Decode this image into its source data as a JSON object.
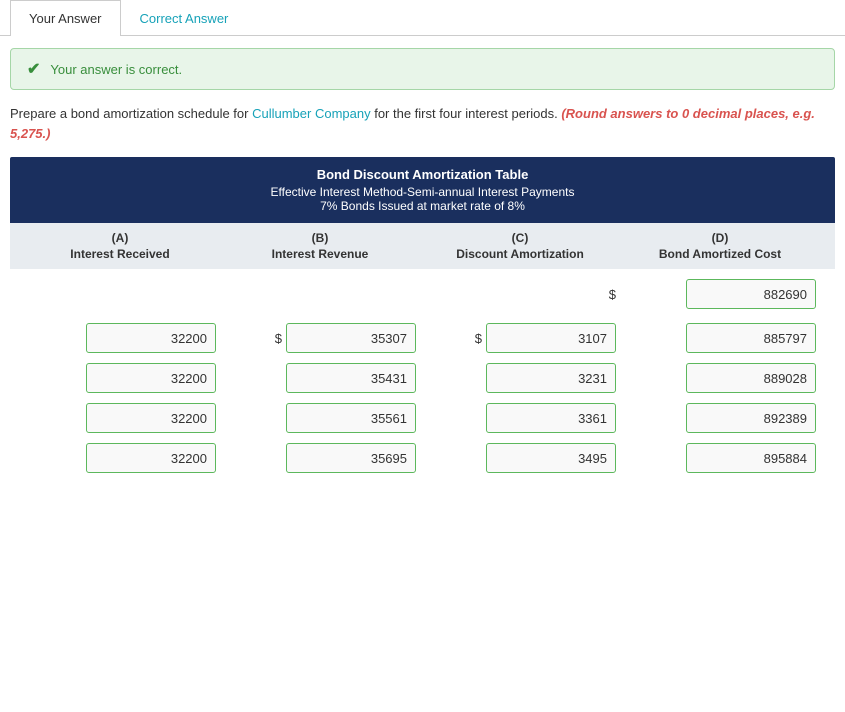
{
  "tabs": {
    "active": "Your Answer",
    "inactive": "Correct Answer"
  },
  "success": {
    "message": "Your answer is correct."
  },
  "instruction": {
    "prefix": "Prepare a bond amortization schedule for ",
    "company": "Cullumber Company",
    "middle": " for the first four interest periods. ",
    "warning": "(Round answers to 0 decimal places, e.g. 5,275.)"
  },
  "table": {
    "title": "Bond Discount Amortization Table",
    "subtitle1": "Effective Interest Method-Semi-annual Interest Payments",
    "subtitle2": "7% Bonds Issued at market rate of 8%",
    "columns": [
      {
        "letter": "(A)",
        "name": "Interest Received"
      },
      {
        "letter": "(B)",
        "name": "Interest Revenue"
      },
      {
        "letter": "(C)",
        "name": "Discount Amortization"
      },
      {
        "letter": "(D)",
        "name": "Bond Amortized Cost"
      }
    ],
    "initial": {
      "col_d": "882690"
    },
    "rows": [
      {
        "a": "32200",
        "b_dollar": "$",
        "b": "35307",
        "c_dollar": "$",
        "c": "3107",
        "d": "885797"
      },
      {
        "a": "32200",
        "b_dollar": "",
        "b": "35431",
        "c_dollar": "",
        "c": "3231",
        "d": "889028"
      },
      {
        "a": "32200",
        "b_dollar": "",
        "b": "35561",
        "c_dollar": "",
        "c": "3361",
        "d": "892389"
      },
      {
        "a": "32200",
        "b_dollar": "",
        "b": "35695",
        "c_dollar": "",
        "c": "3495",
        "d": "895884"
      }
    ]
  }
}
